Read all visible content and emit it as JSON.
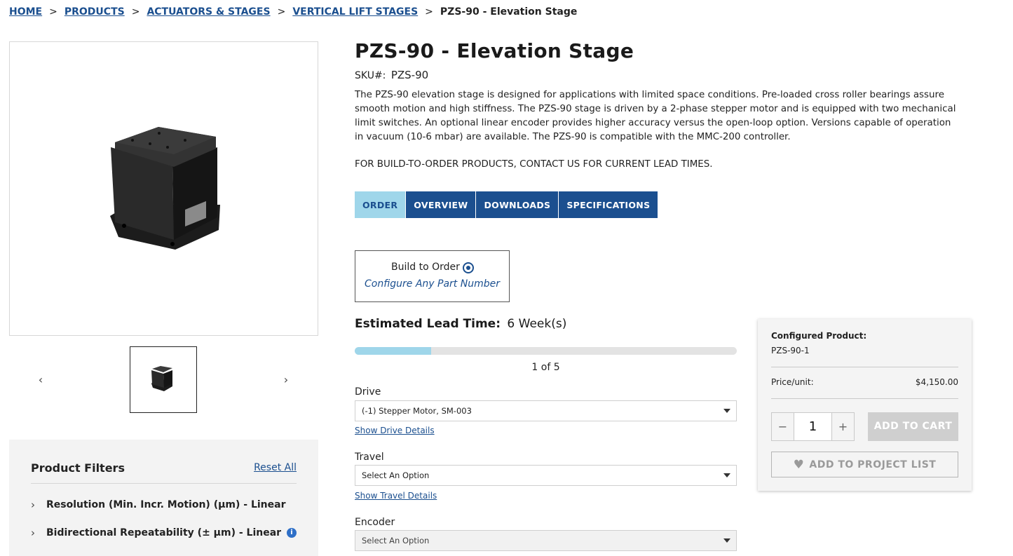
{
  "breadcrumb": {
    "items": [
      "HOME",
      "PRODUCTS",
      "ACTUATORS & STAGES",
      "VERTICAL LIFT STAGES"
    ],
    "separator": ">",
    "current": "PZS-90 - Elevation Stage"
  },
  "gallery": {
    "prev_icon": "‹",
    "next_icon": "›",
    "thumbnail_count": 1
  },
  "filters": {
    "title": "Product Filters",
    "reset_label": "Reset All",
    "chevron_icon": "›",
    "items": [
      {
        "label": "Resolution (Min. Incr. Motion) (μm) - Linear",
        "info": false
      },
      {
        "label": "Bidirectional Repeatability (± μm) - Linear",
        "info": true,
        "info_icon": "i"
      }
    ]
  },
  "product": {
    "title": "PZS-90 - Elevation Stage",
    "sku_label": "SKU#:",
    "sku_value": "PZS-90",
    "description": "The PZS-90 elevation stage is designed for applications with limited space conditions. Pre-loaded cross roller bearings assure smooth motion and high stiffness. The PZS-90 stage is driven by a 2-phase stepper motor and is equipped with two mechanical limit switches. An optional linear encoder provides higher accuracy versus the open-loop option. Versions capable of operation in vacuum (10-6 mbar) are available. The PZS-90 is compatible with the MMC-200 controller.",
    "notice": "FOR BUILD-TO-ORDER PRODUCTS, CONTACT US FOR CURRENT LEAD TIMES."
  },
  "tabs": [
    {
      "label": "ORDER",
      "active": true
    },
    {
      "label": "OVERVIEW",
      "active": false
    },
    {
      "label": "DOWNLOADS",
      "active": false
    },
    {
      "label": "SPECIFICATIONS",
      "active": false
    }
  ],
  "build_to_order": {
    "label": "Build to Order",
    "sublabel": "Configure Any Part Number",
    "selected": true
  },
  "lead_time": {
    "label": "Estimated Lead Time:",
    "value": "6 Week(s)"
  },
  "progress": {
    "text": "1 of 5",
    "step": 1,
    "total": 5
  },
  "options": {
    "drive": {
      "label": "Drive",
      "value": "(-1) Stepper Motor, SM-003",
      "details": "Show Drive Details"
    },
    "travel": {
      "label": "Travel",
      "value": "Select An Option",
      "details": "Show Travel Details"
    },
    "encoder": {
      "label": "Encoder",
      "value": "Select An Option"
    }
  },
  "cart": {
    "configured_label": "Configured Product:",
    "configured_value": "PZS-90-1",
    "price_label": "Price/unit:",
    "price_value": "$4,150.00",
    "quantity": "1",
    "minus_icon": "−",
    "plus_icon": "+",
    "add_to_cart": "ADD TO CART",
    "add_to_project": "ADD TO PROJECT LIST",
    "heart_icon": "♥"
  },
  "colors": {
    "brand": "#1b4f8f",
    "accent": "#9fd6ea"
  }
}
